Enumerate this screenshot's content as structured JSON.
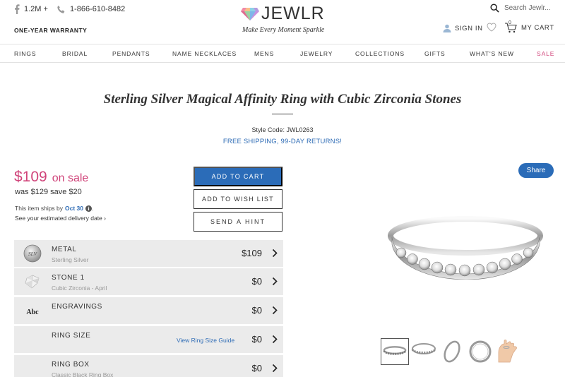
{
  "header": {
    "social_count": "1.2M +",
    "phone": "1-866-610-8482",
    "warranty": "ONE-YEAR WARRANTY",
    "logo_text": "JEWLR",
    "tagline": "Make Every Moment Sparkle",
    "search_placeholder": "Search Jewlr...",
    "sign_in": "SIGN IN",
    "cart_label": "MY CART",
    "cart_count": "0"
  },
  "nav": {
    "items": [
      "RINGS",
      "BRIDAL",
      "PENDANTS",
      "NAME NECKLACES",
      "MENS",
      "JEWELRY",
      "COLLECTIONS",
      "GIFTS",
      "WHAT'S NEW",
      "SALE"
    ]
  },
  "product": {
    "title": "Sterling Silver Magical Affinity Ring with Cubic Zirconia Stones",
    "style_code": "Style Code: JWL0263",
    "shipping_promo": "FREE SHIPPING, 99-DAY RETURNS!",
    "sale_price": "$109",
    "on_sale": "on sale",
    "was_price": "was $129 save $20",
    "ships_by_text": "This item ships by",
    "ship_date": "Oct 30",
    "delivery_link": "See your estimated delivery date ›"
  },
  "actions": {
    "add_to_cart": "ADD TO CART",
    "add_to_wish_list": "ADD TO WISH LIST",
    "send_hint": "SEND A HINT",
    "share": "Share"
  },
  "options": [
    {
      "label": "METAL",
      "sub": "Sterling Silver",
      "price": "$109",
      "icon": "metal-swatch-icon",
      "icon_text": "SLV"
    },
    {
      "label": "STONE 1",
      "sub": "Cubic Zirconia - April",
      "price": "$0",
      "icon": "gemstone-icon"
    },
    {
      "label": "ENGRAVINGS",
      "sub": "",
      "price": "$0",
      "icon": "engraving-icon",
      "icon_text": "Abc"
    },
    {
      "label": "RING SIZE",
      "sub": "",
      "price": "$0",
      "guide": "View Ring Size Guide"
    },
    {
      "label": "RING BOX",
      "sub": "Classic Black Ring Box",
      "price": "$0"
    }
  ],
  "colors": {
    "accent_blue": "#2b6cb8",
    "sale_pink": "#d0447a",
    "option_bg": "#ebebeb"
  }
}
